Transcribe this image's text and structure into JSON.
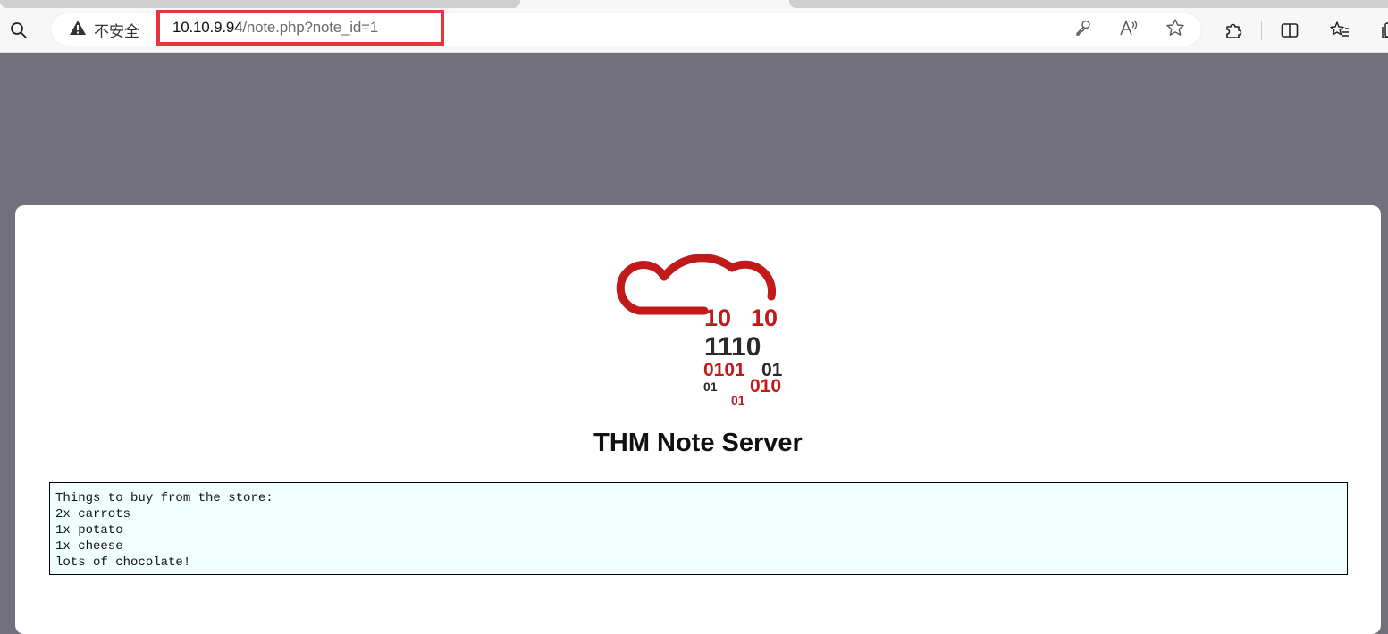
{
  "browser": {
    "security_label": "不安全",
    "url_host": "10.10.9.94",
    "url_path": "/note.php?note_id=1",
    "highlight_color": "#e8343a",
    "icons": [
      "search-icon",
      "warning-icon",
      "key-icon",
      "read-aloud-icon",
      "favorite-star-icon",
      "extensions-icon",
      "split-screen-icon",
      "favorites-icon",
      "collections-icon"
    ]
  },
  "page": {
    "logo": {
      "binary_lines": [
        "10",
        "10",
        "1110",
        "0101",
        "01",
        "01",
        "01",
        "010"
      ],
      "accent_color": "#c01a1a",
      "dark_color": "#2a2a2a"
    },
    "title": "THM Note Server",
    "note_lines": [
      "Things to buy from the store:",
      "2x carrots",
      "1x potato",
      "1x cheese",
      "lots of chocolate!"
    ]
  }
}
